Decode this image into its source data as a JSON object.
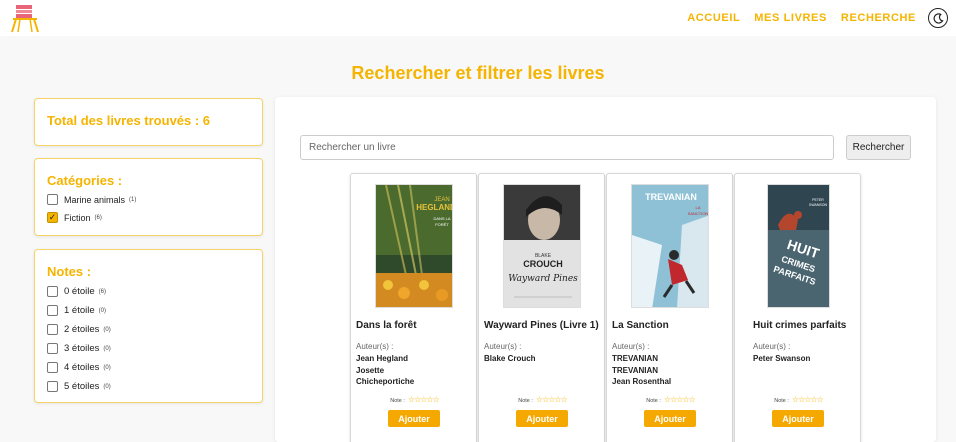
{
  "nav": {
    "items": [
      "ACCUEIL",
      "MES LIVRES",
      "RECHERCHE"
    ]
  },
  "page_title": "Rechercher et filtrer les livres",
  "total": {
    "label": "Total des livres trouvés : 6"
  },
  "categories": {
    "title": "Catégories :",
    "items": [
      {
        "label": "Marine animals",
        "count": "(1)",
        "checked": false
      },
      {
        "label": "Fiction",
        "count": "(6)",
        "checked": true
      }
    ]
  },
  "notes": {
    "title": "Notes :",
    "items": [
      {
        "label": "0 étoile",
        "count": "(6)"
      },
      {
        "label": "1 étoile",
        "count": "(0)"
      },
      {
        "label": "2 étoiles",
        "count": "(0)"
      },
      {
        "label": "3 étoiles",
        "count": "(0)"
      },
      {
        "label": "4 étoiles",
        "count": "(0)"
      },
      {
        "label": "5 étoiles",
        "count": "(0)"
      }
    ]
  },
  "search": {
    "placeholder": "Rechercher un livre",
    "button": "Rechercher"
  },
  "books": [
    {
      "title": "Dans la forêt",
      "authors_label": "Auteur(s) :",
      "authors": [
        "Jean Hegland",
        "Josette",
        "Chicheportiche"
      ],
      "rating_label": "Note :",
      "stars": "☆☆☆☆☆",
      "button": "Ajouter",
      "cover": {
        "bg": "#2f4a2a",
        "accent": "#e8c23a",
        "l1": "JEAN",
        "l2": "HEGLAND",
        "l3": "DANS LA FORÊT"
      }
    },
    {
      "title": "Wayward Pines (Livre 1)",
      "authors_label": "Auteur(s) :",
      "authors": [
        "Blake Crouch"
      ],
      "rating_label": "Note :",
      "stars": "☆☆☆☆☆",
      "button": "Ajouter",
      "cover": {
        "bg": "#d9d9d9",
        "accent": "#333333",
        "l1": "BLAKE",
        "l2": "CROUCH",
        "l3": "Wayward Pines"
      }
    },
    {
      "title": "La Sanction",
      "authors_label": "Auteur(s) :",
      "authors": [
        "TREVANIAN",
        "TREVANIAN",
        "Jean Rosenthal"
      ],
      "rating_label": "Note :",
      "stars": "☆☆☆☆☆",
      "button": "Ajouter",
      "cover": {
        "bg": "#7fb6cf",
        "accent": "#c0282d",
        "l1": "TREVANIAN",
        "l2": "LA",
        "l3": "SANCTION"
      }
    },
    {
      "title": "Huit crimes parfaits",
      "authors_label": "Auteur(s) :",
      "authors": [
        "Peter Swanson"
      ],
      "rating_label": "Note :",
      "stars": "☆☆☆☆☆",
      "button": "Ajouter",
      "cover": {
        "bg": "#4a6470",
        "accent": "#ffffff",
        "l1": "PETER SWANSON",
        "l2": "HUIT",
        "l3": "CRIMES PARFAITS"
      }
    }
  ]
}
